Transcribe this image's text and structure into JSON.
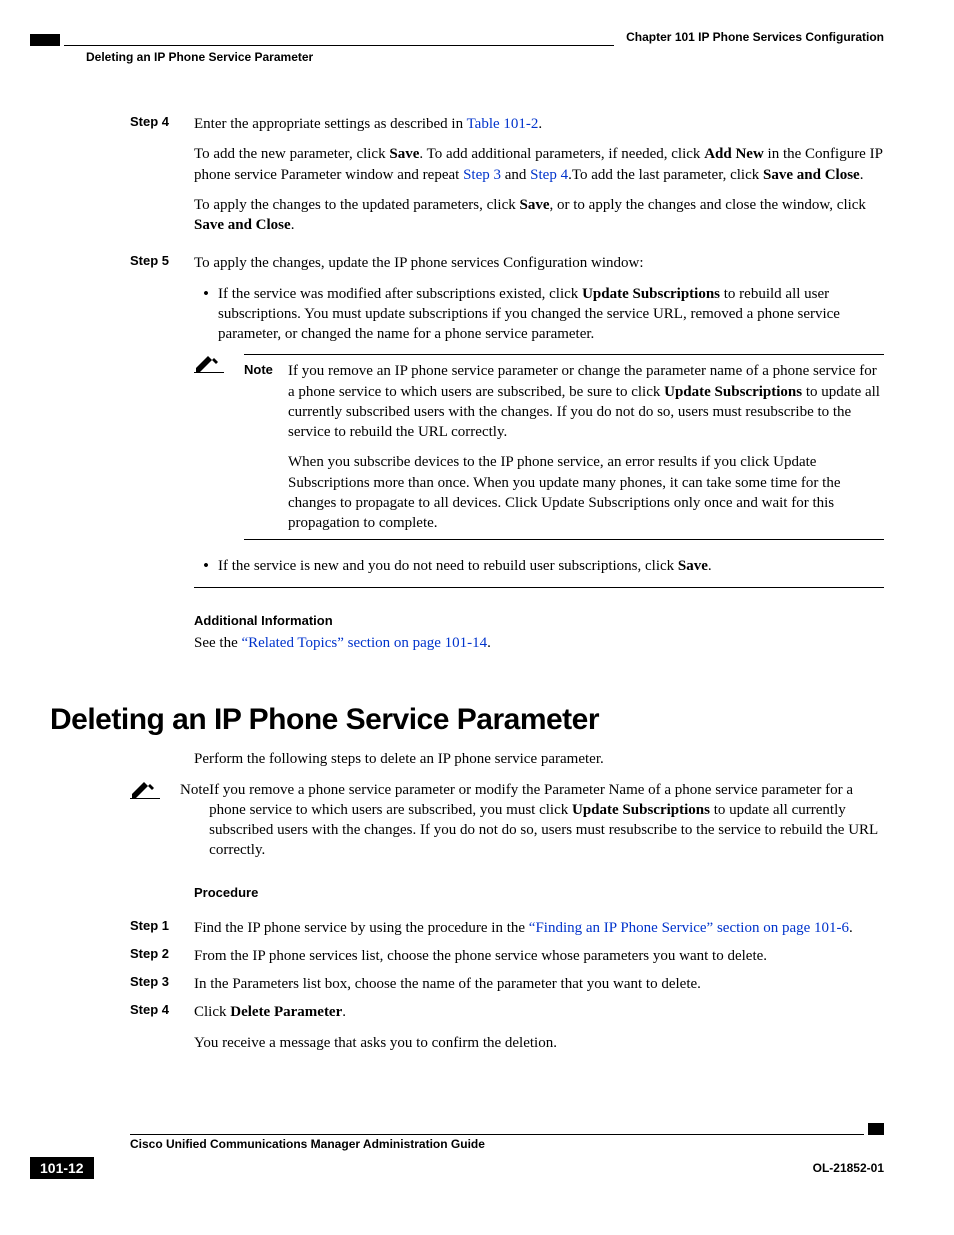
{
  "header": {
    "chapter": "Chapter 101    IP Phone Services Configuration",
    "subheader": "Deleting an IP Phone Service Parameter"
  },
  "step4": {
    "label": "Step 4",
    "p1_a": "Enter the appropriate settings as described in ",
    "p1_link": "Table 101-2",
    "p1_b": ".",
    "p2_a": "To add the new parameter, click ",
    "p2_save": "Save",
    "p2_b": ". To add additional parameters, if needed, click ",
    "p2_addnew": "Add New",
    "p2_c": " in the Configure IP phone service Parameter window and repeat ",
    "p2_link1": "Step 3",
    "p2_d": " and ",
    "p2_link2": "Step 4",
    "p2_e": ".To add the last parameter, click ",
    "p2_saveclose": "Save and Close",
    "p2_f": ".",
    "p3_a": "To apply the changes to the updated parameters, click ",
    "p3_save": "Save",
    "p3_b": ", or to apply the changes and close the window, click ",
    "p3_saveclose": "Save and Close",
    "p3_c": "."
  },
  "step5": {
    "label": "Step 5",
    "intro": "To apply the changes, update the IP phone services Configuration window:",
    "b1_a": "If the service was modified after subscriptions existed, click ",
    "b1_us": "Update Subscriptions",
    "b1_b": " to rebuild all user subscriptions. You must update subscriptions if you changed the service URL, removed a phone service parameter, or changed the name for a phone service parameter.",
    "note_label": "Note",
    "note_p1_a": "If you remove an IP phone service parameter or change the parameter name of a phone service for a phone service to which users are subscribed, be sure to click ",
    "note_p1_us": "Update Subscriptions",
    "note_p1_b": " to update all currently subscribed users with the changes. If you do not do so, users must resubscribe to the service to rebuild the URL correctly.",
    "note_p2": "When you subscribe devices to the IP phone service, an error results if you click Update Subscriptions more than once. When you update many phones, it can take some time for the changes to propagate to all devices. Click Update Subscriptions only once and wait for this propagation to complete.",
    "b2_a": "If the service is new and you do not need to rebuild user subscriptions, click ",
    "b2_save": "Save",
    "b2_b": "."
  },
  "addl": {
    "heading": "Additional Information",
    "a": "See the ",
    "link": "“Related Topics” section on page 101-14",
    "b": "."
  },
  "section": {
    "title": "Deleting an IP Phone Service Parameter",
    "intro": "Perform the following steps to delete an IP phone service parameter.",
    "note_label": "Note",
    "note_a": "If you remove a phone service parameter or modify the Parameter Name of a phone service parameter for a phone service to which users are subscribed, you must click ",
    "note_us": "Update Subscriptions",
    "note_b": " to update all currently subscribed users with the changes. If you do not do so, users must resubscribe to the service to rebuild the URL correctly.",
    "procedure": "Procedure",
    "s1_label": "Step 1",
    "s1_a": "Find the IP phone service by using the procedure in the ",
    "s1_link": "“Finding an IP Phone Service” section on page 101-6",
    "s1_b": ".",
    "s2_label": "Step 2",
    "s2": "From the IP phone services list, choose the phone service whose parameters you want to delete.",
    "s3_label": "Step 3",
    "s3": "In the Parameters list box, choose the name of the parameter that you want to delete.",
    "s4_label": "Step 4",
    "s4_a": "Click ",
    "s4_dp": "Delete Parameter",
    "s4_b": ".",
    "s4_p2": "You receive a message that asks you to confirm the deletion."
  },
  "footer": {
    "guide": "Cisco Unified Communications Manager Administration Guide",
    "page": "101-12",
    "ol": "OL-21852-01"
  }
}
